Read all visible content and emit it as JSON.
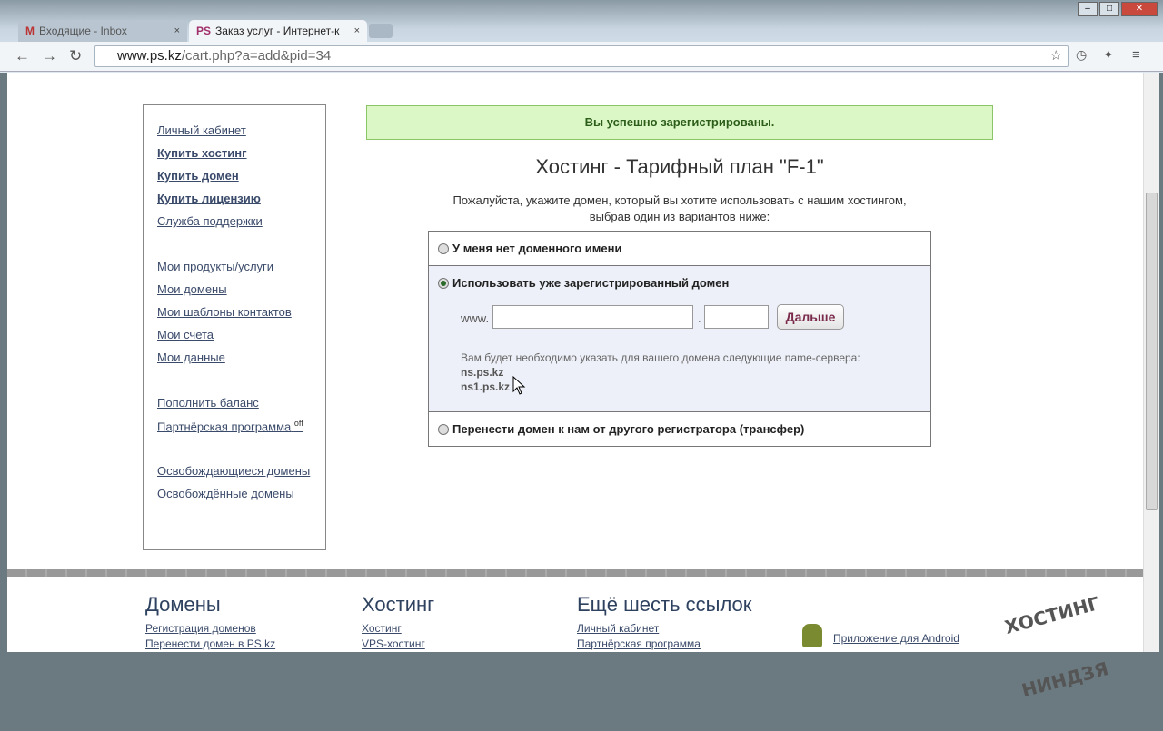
{
  "browser": {
    "tabs": [
      {
        "label": "Входящие - Inbox",
        "active": false
      },
      {
        "label": "Заказ услуг - Интернет-к",
        "active": true
      }
    ],
    "url_host": "www.ps.kz",
    "url_path": "/cart.php?a=add&pid=34",
    "close": "×"
  },
  "sidebar": {
    "items": [
      "Личный кабинет",
      "Купить хостинг",
      "Купить домен",
      "Купить лицензию",
      "Служба поддержки",
      "Мои продукты/услуги",
      "Мои домены",
      "Мои шаблоны контактов",
      "Мои счета",
      "Мои данные",
      "Пополнить баланс",
      "Партнёрская программа",
      "Освобождающиеся домены",
      "Освобождённые домены"
    ],
    "partner_badge": "off"
  },
  "main": {
    "success": "Вы успешно зарегистрированы.",
    "title": "Хостинг - Тарифный план \"F-1\"",
    "intro": "Пожалуйста, укажите домен, который вы хотите использовать с нашим хостингом, выбрав один из вариантов ниже:",
    "options": [
      {
        "label": "У меня нет доменного имени",
        "selected": false
      },
      {
        "label": "Использовать уже зарегистрированный домен",
        "selected": true
      },
      {
        "label": "Перенести домен к нам от другого регистратора (трансфер)",
        "selected": false
      }
    ],
    "www": "www.",
    "dot": ".",
    "sld_value": "",
    "tld_value": "",
    "next_button": "Дальше",
    "ns_note": "Вам будет необходимо указать для вашего домена следующие name-сервера:",
    "ns1": "ns.ps.kz",
    "ns2": "ns1.ps.kz"
  },
  "footer": {
    "col1": {
      "title": "Домены",
      "links": [
        "Регистрация доменов",
        "Перенести домен в PS.kz"
      ]
    },
    "col2": {
      "title": "Хостинг",
      "links": [
        "Хостинг",
        "VPS-хостинг"
      ]
    },
    "col3": {
      "title": "Ещё шесть ссылок",
      "links": [
        "Личный кабинет",
        "Партнёрская программа"
      ]
    },
    "android": "Приложение для Android"
  },
  "watermark": "Хостинг-Ниндзя"
}
